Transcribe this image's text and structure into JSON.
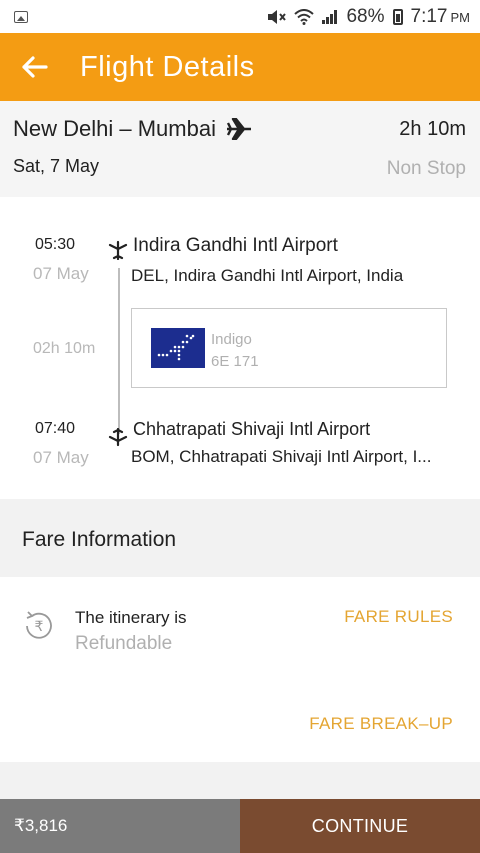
{
  "status_bar": {
    "battery": "68%",
    "time": "7:17",
    "ampm": "PM"
  },
  "app_bar": {
    "title": "Flight Details"
  },
  "route": {
    "cities": "New Delhi – Mumbai",
    "duration": "2h 10m",
    "date": "Sat, 7 May",
    "stops": "Non Stop"
  },
  "itinerary": {
    "departure": {
      "time": "05:30",
      "date": "07 May",
      "airport": "Indira Gandhi Intl Airport",
      "detail": "DEL, Indira Gandhi Intl Airport, India"
    },
    "flight_duration": "02h 10m",
    "airline": {
      "name": "Indigo",
      "flight_no": "6E 171",
      "logo_color": "#1c2d8f"
    },
    "arrival": {
      "time": "07:40",
      "date": "07 May",
      "airport": "Chhatrapati Shivaji Intl Airport",
      "detail": "BOM, Chhatrapati Shivaji Intl Airport, I..."
    }
  },
  "fare": {
    "header": "Fare Information",
    "itinerary_text": "The itinerary is",
    "refund_status": "Refundable",
    "fare_rules": "FARE RULES",
    "fare_breakup": "FARE BREAK–UP"
  },
  "bottom": {
    "price": "₹3,816",
    "continue": "CONTINUE"
  },
  "colors": {
    "accent": "#f49c13",
    "link": "#e4a532",
    "continue_bg": "#7a4b30"
  }
}
